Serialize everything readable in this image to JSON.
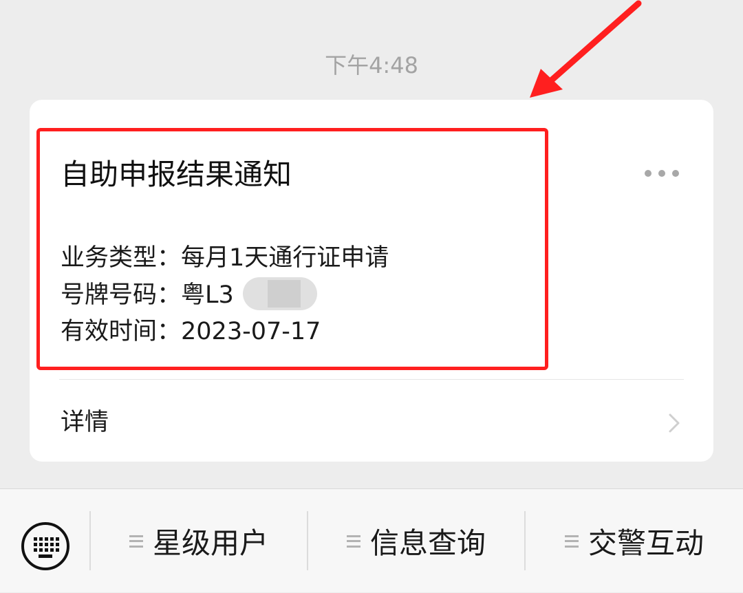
{
  "chat": {
    "timestamp": "下午4:48"
  },
  "card": {
    "title": "自助申报结果通知",
    "fields": [
      {
        "label": "业务类型：",
        "value": "每月1天通行证申请"
      },
      {
        "label": "号牌号码：",
        "value": "粤L3"
      },
      {
        "label": "有效时间：",
        "value": "2023-07-17"
      }
    ],
    "details_label": "详情",
    "more_icon": "more-horizontal-icon",
    "chevron_icon": "chevron-right-icon"
  },
  "annotation": {
    "highlight_color": "#ff1f1f"
  },
  "bottom_menu": {
    "keyboard_icon": "keyboard-icon",
    "items": [
      {
        "label": "星级用户",
        "icon": "hamburger-icon"
      },
      {
        "label": "信息查询",
        "icon": "hamburger-icon"
      },
      {
        "label": "交警互动",
        "icon": "hamburger-icon"
      }
    ]
  }
}
